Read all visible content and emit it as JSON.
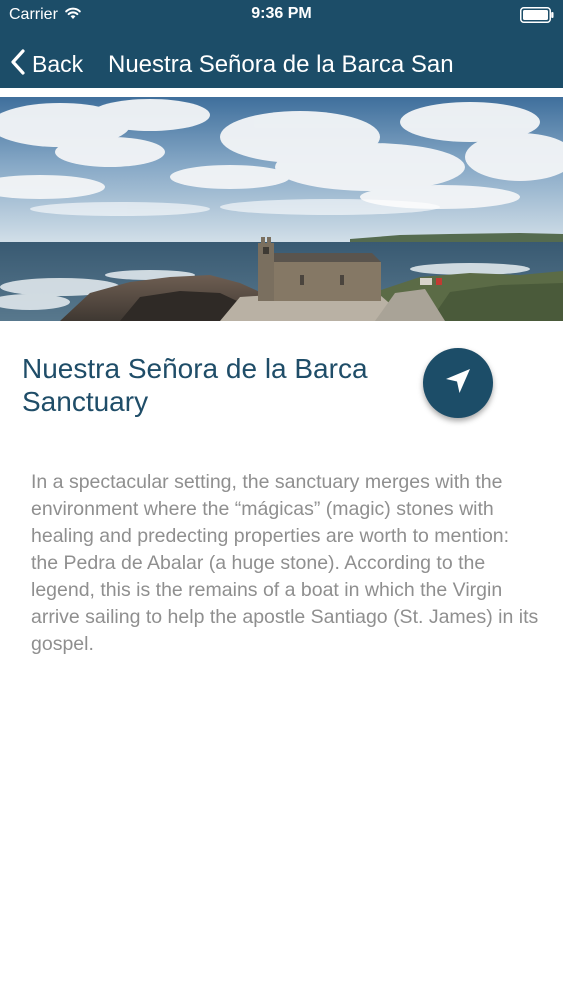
{
  "status_bar": {
    "carrier": "Carrier",
    "time": "9:36 PM",
    "icons": [
      "wifi-icon",
      "battery-icon"
    ]
  },
  "nav": {
    "back_label": "Back",
    "title": "Nuestra Señora de la Barca San",
    "icons": [
      "chevron-left-icon"
    ]
  },
  "place": {
    "title": "Nuestra Señora de la Barca Sanctuary",
    "description": "In a spectacular setting, the sanctuary merges with the environment where the “mágicas” (magic) stones with healing and predecting properties are worth to mention: the Pedra de Abalar (a huge stone). According to the legend, this is the remains of a boat in which the Virgin arrive sailing to help the apostle Santiago (St. James) in its gospel.",
    "directions_icon": "location-arrow-icon"
  },
  "colors": {
    "nav_background": "#1c4d68",
    "title_text": "#1f4d68",
    "body_text": "#8f8f8f"
  }
}
